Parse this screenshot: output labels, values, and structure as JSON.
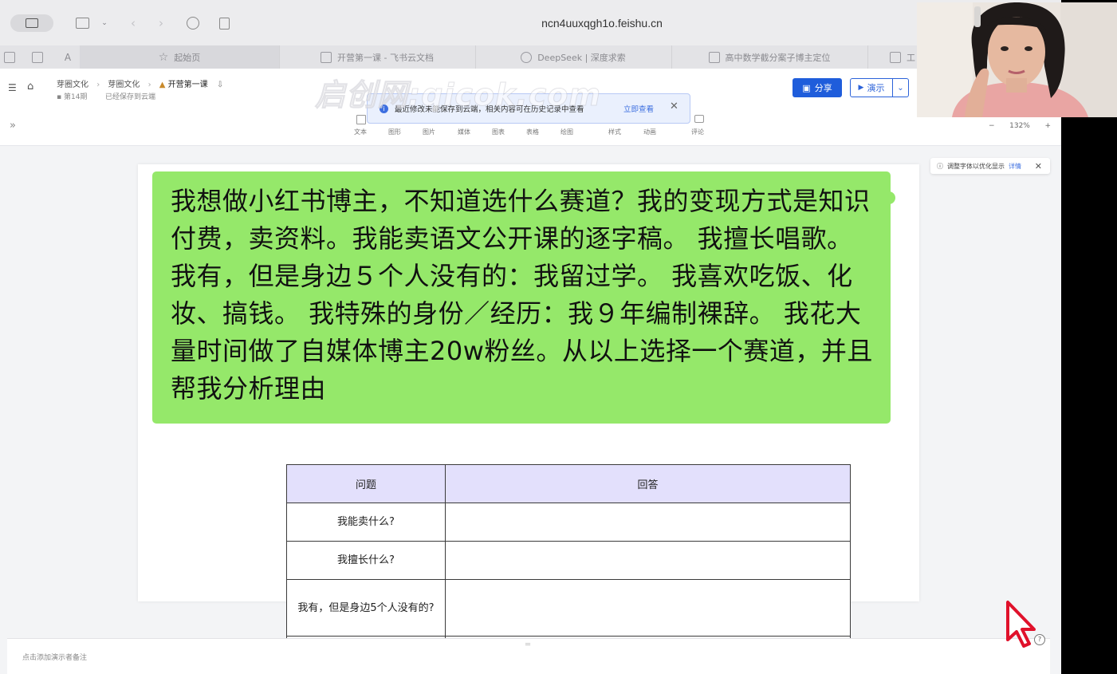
{
  "browser": {
    "url": "ncn4uuxqgh1o.feishu.cn",
    "tabs": [
      {
        "label": "起始页",
        "active": true
      },
      {
        "label": "开营第一课 - 飞书云文档",
        "active": false
      },
      {
        "label": "DeepSeek | 深度求索",
        "active": false
      },
      {
        "label": "高中数学截分案子博主定位",
        "active": false
      },
      {
        "label": "工",
        "active": false
      }
    ]
  },
  "header": {
    "breadcrumb": [
      "芽圈文化",
      "芽圈文化",
      "开营第一课"
    ],
    "meta_label": "第14期",
    "save_status": "已经保存到云端",
    "share_label": "分享",
    "present_label": "演示"
  },
  "notice": {
    "text": "最近修改未能保存到云端，相关内容可在历史记录中查看",
    "link": "立即查看"
  },
  "tools": [
    "文本",
    "图形",
    "图片",
    "媒体",
    "图表",
    "表格",
    "绘图",
    "样式",
    "动画",
    "评论"
  ],
  "zoom": {
    "value": "132%"
  },
  "watermark": "启创网:qicok.com",
  "tip": {
    "text": "调整字体以优化显示",
    "link": "详情"
  },
  "slide": {
    "bubble_text": "我想做小红书博主，不知道选什么赛道？我的变现方式是知识付费，卖资料。我能卖语文公开课的逐字稿。 我擅长唱歌。 我有，但是身边５个人没有的：我留过学。 我喜欢吃饭、化妆、搞钱。 我特殊的身份／经历：我９年编制裸辞。 我花大量时间做了自媒体博主20w粉丝。从以上选择一个赛道，并且帮我分析理由",
    "table": {
      "headers": [
        "问题",
        "回答"
      ],
      "rows": [
        {
          "q": "我能卖什么?",
          "a": ""
        },
        {
          "q": "我擅长什么?",
          "a": ""
        },
        {
          "q": "我有，但是身边5个人没有的?",
          "a": ""
        }
      ]
    }
  },
  "footer": {
    "notes_placeholder": "点击添加演示者备注"
  },
  "colors": {
    "bubble": "#95e86a",
    "table_header": "#e3e0fc",
    "primary": "#1f5ddb"
  }
}
